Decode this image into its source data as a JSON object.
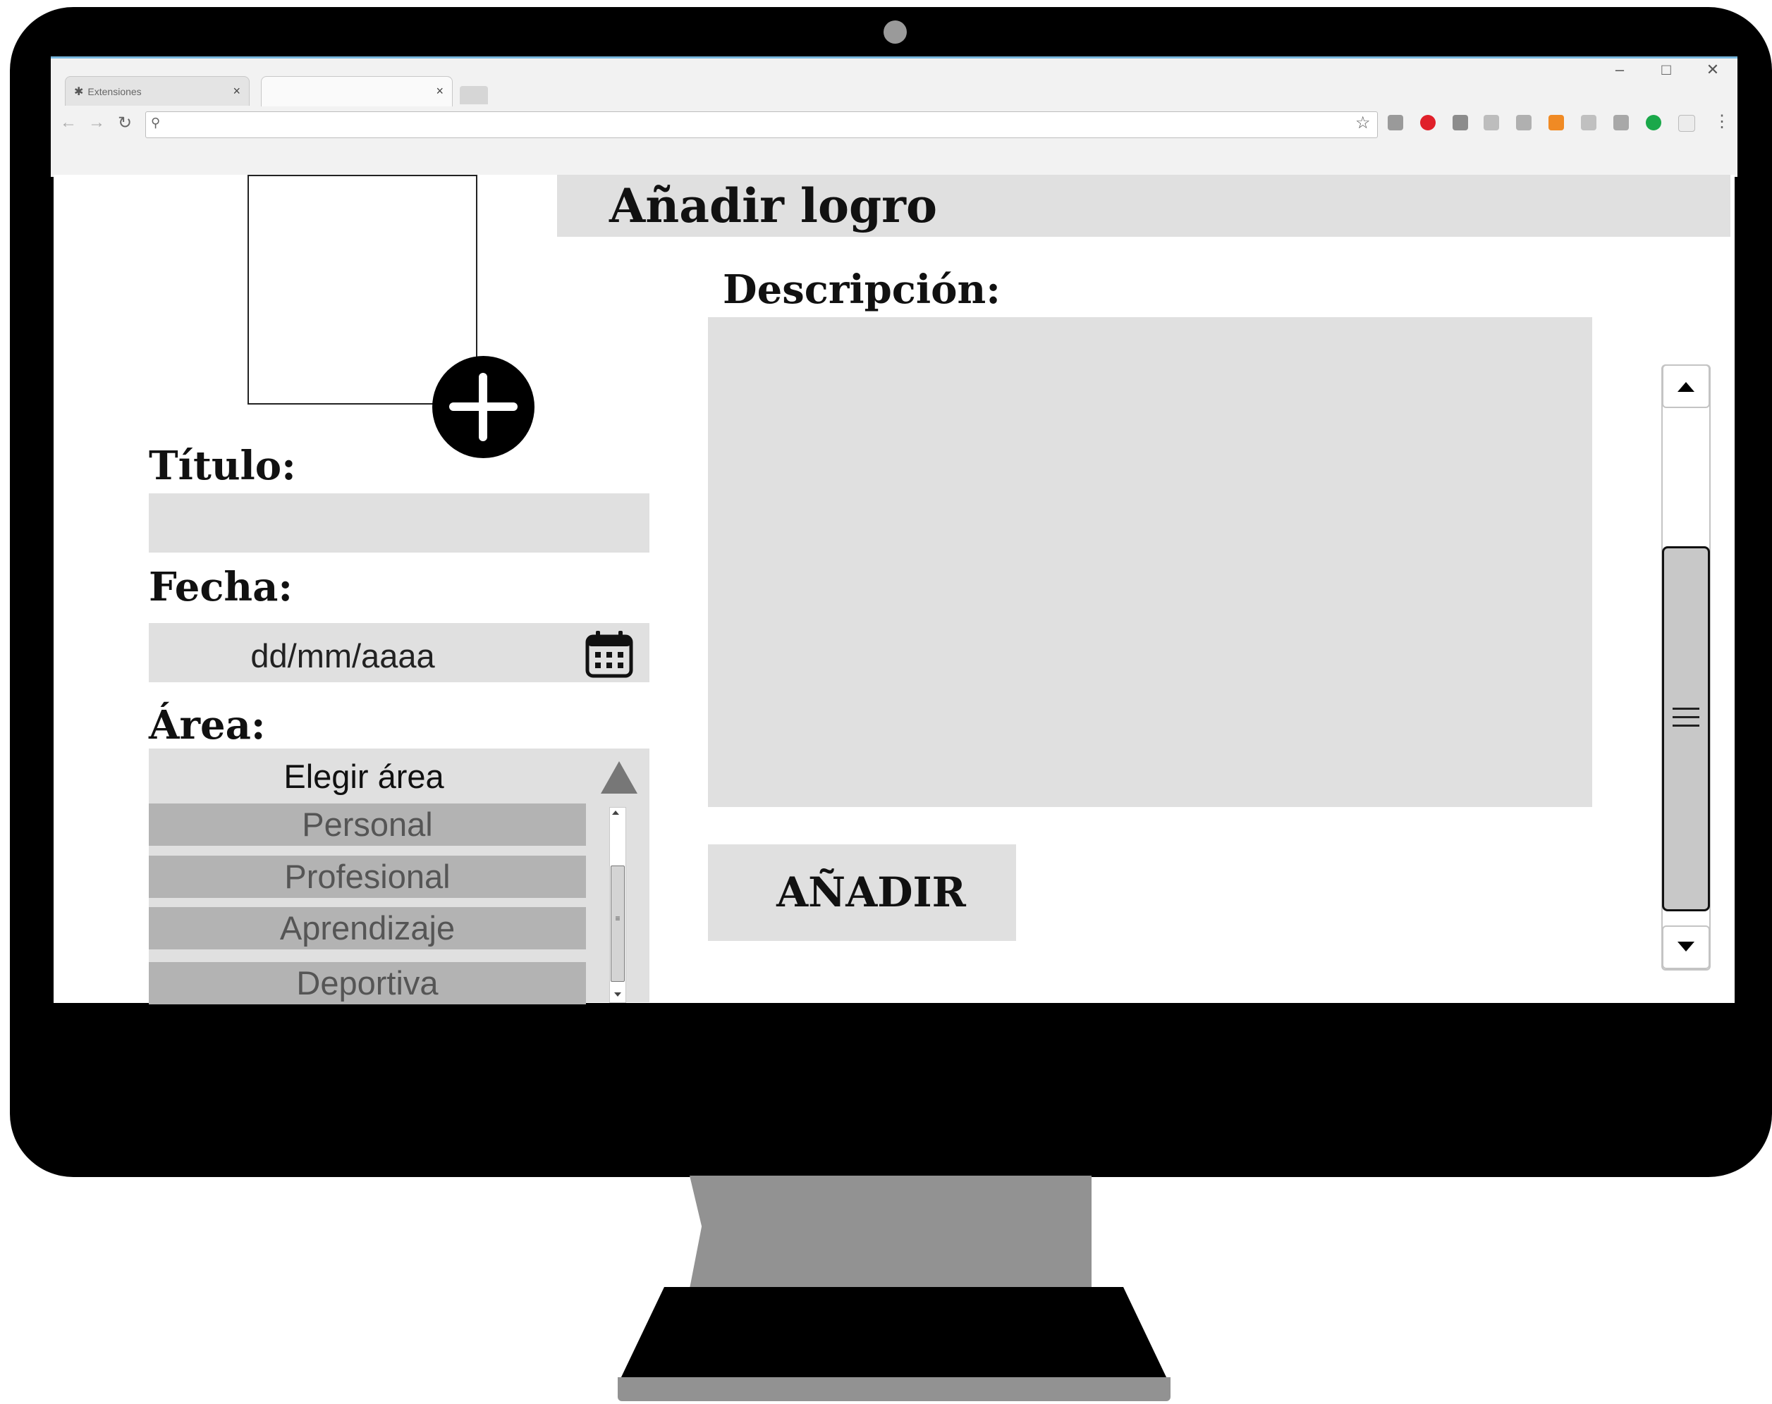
{
  "browser": {
    "tabs": [
      {
        "label": "Extensiones",
        "active": false
      },
      {
        "label": "",
        "active": true
      }
    ],
    "close_glyph": "×",
    "window_controls": {
      "minimize": "–",
      "maximize": "□",
      "close": "✕"
    },
    "address": {
      "value": ""
    },
    "nav_icons": [
      "back-icon",
      "forward-icon",
      "reload-icon"
    ],
    "toolbar_icons": [
      "bookmark-star-icon",
      "extension-icon",
      "adblock-icon",
      "extension-icon",
      "extension-icon",
      "extension-icon",
      "extension-icon",
      "extension-icon",
      "extension-icon",
      "extension-icon",
      "extension-icon",
      "menu-icon"
    ],
    "accent_color": "#78b7de"
  },
  "page": {
    "title": "Añadir logro",
    "photo": {
      "add_icon": "plus-circle-icon"
    },
    "titulo": {
      "label": "Título:",
      "value": ""
    },
    "fecha": {
      "label": "Fecha:",
      "placeholder": "dd/mm/aaaa",
      "icon": "calendar-icon"
    },
    "area": {
      "label": "Área:",
      "selected": "Elegir área",
      "options": [
        "Personal",
        "Profesional",
        "Aprendizaje",
        "Deportiva"
      ]
    },
    "descripcion": {
      "label": "Descripción:",
      "value": ""
    },
    "submit_label": "AÑADIR"
  },
  "colors": {
    "field_bg": "#e0e0e0",
    "option_bg": "#b3b3b3",
    "bezel": "#000000",
    "stand": "#929292"
  }
}
